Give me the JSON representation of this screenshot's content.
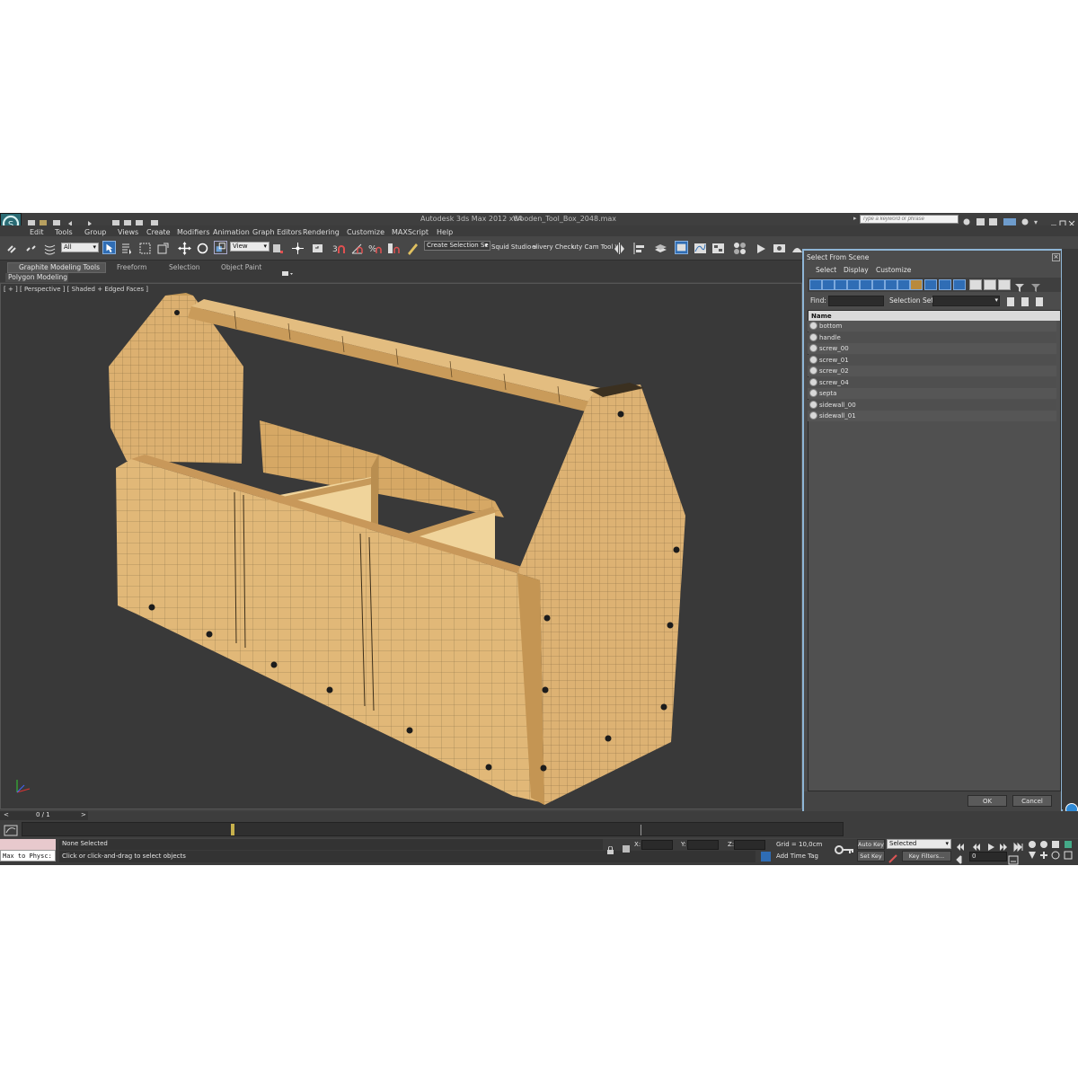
{
  "app": {
    "title": "Autodesk 3ds Max  2012 x64",
    "file": "Wooden_Tool_Box_2048.max",
    "search_placeholder": "Type a keyword or phrase"
  },
  "menu": [
    "Edit",
    "Tools",
    "Group",
    "Views",
    "Create",
    "Modifiers",
    "Animation",
    "Graph Editors",
    "Rendering",
    "Customize",
    "MAXScript",
    "Help"
  ],
  "toolbar": {
    "selection_filter": "All",
    "reference_coord": "View",
    "named_selection": "Create Selection Se",
    "extra_labels": [
      "Squid Studio v",
      "elivery Check",
      "uty Cam Tool \\"
    ]
  },
  "ribbon": {
    "tabs": [
      "Graphite Modeling Tools",
      "Freeform",
      "Selection",
      "Object Paint"
    ],
    "panel": "Polygon Modeling"
  },
  "viewport": {
    "label": "[ + ] [ Perspective ] [ Shaded + Edged Faces ]"
  },
  "dialog": {
    "title": "Select From Scene",
    "menu": [
      "Select",
      "Display",
      "Customize"
    ],
    "find_label": "Find:",
    "selection_set_label": "Selection Set:",
    "column_header": "Name",
    "objects": [
      "bottom",
      "handle",
      "screw_00",
      "screw_01",
      "screw_02",
      "screw_04",
      "septa",
      "sidewall_00",
      "sidewall_01"
    ],
    "ok": "OK",
    "cancel": "Cancel"
  },
  "timeline": {
    "frame": "0 / 1",
    "prev": "<",
    "next": ">"
  },
  "status": {
    "maxscript": "Max to Physc:",
    "selection": "None Selected",
    "prompt": "Click or click-and-drag to select objects",
    "x_label": "X:",
    "y_label": "Y:",
    "z_label": "Z:",
    "grid": "Grid = 10,0cm",
    "add_time_tag": "Add Time Tag",
    "auto_key": "Auto Key",
    "set_key": "Set Key",
    "key_mode": "Selected",
    "key_filters": "Key Filters...",
    "current_frame": "0"
  },
  "colors": {
    "wood": "#e0b877",
    "viewport_bg": "#393939",
    "accent_blue": "#2f6db5"
  }
}
